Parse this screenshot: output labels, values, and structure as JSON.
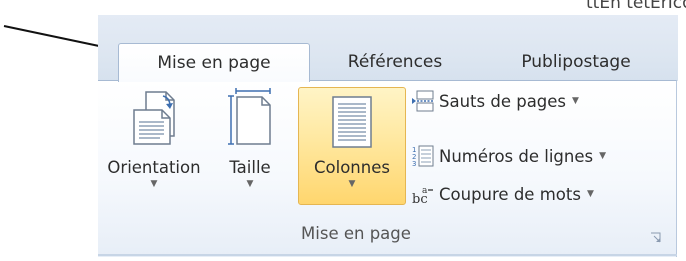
{
  "window": {
    "title_partial": "ttEn tetErIco"
  },
  "tabs": [
    {
      "label": "Mise en page",
      "active": true
    },
    {
      "label": "Références",
      "active": false
    },
    {
      "label": "Publipostage",
      "active": false
    }
  ],
  "group": {
    "label": "Mise en page",
    "buttons": {
      "orientation": "Orientation",
      "taille": "Taille",
      "colonnes": "Colonnes"
    },
    "small_buttons": {
      "sauts": "Sauts de pages",
      "numeros": "Numéros de lignes",
      "coupure": "Coupure de mots"
    }
  },
  "colors": {
    "highlight": "#ffd66e",
    "ribbon_border": "#a7bad3"
  },
  "icons": [
    "arrow",
    "orientation-icon",
    "size-icon",
    "columns-icon",
    "page-break-icon",
    "line-numbers-icon",
    "hyphenation-icon",
    "dialog-launcher-icon"
  ]
}
